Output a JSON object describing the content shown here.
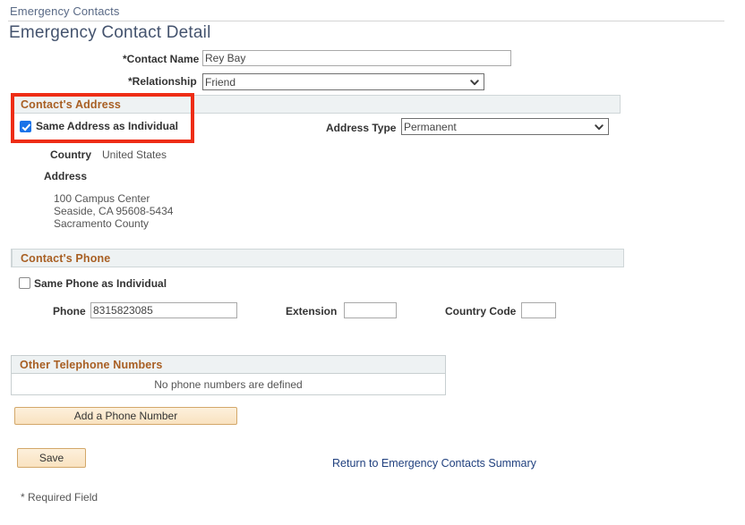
{
  "breadcrumb": {
    "label": "Emergency Contacts"
  },
  "page": {
    "title": "Emergency Contact Detail",
    "required_note": "* Required Field"
  },
  "contact": {
    "name_label": "*Contact Name",
    "name_value": "Rey Bay",
    "relationship_label": "*Relationship",
    "relationship_value": "Friend"
  },
  "address_section": {
    "header": "Contact's Address",
    "same_as_individual_label": "Same Address as Individual",
    "same_as_individual_checked": true,
    "address_type_label": "Address Type",
    "address_type_value": "Permanent",
    "country_label": "Country",
    "country_value": "United States",
    "address_label": "Address",
    "address_lines": [
      "100 Campus Center",
      "Seaside, CA 95608-5434",
      "Sacramento County"
    ]
  },
  "phone_section": {
    "header": "Contact's Phone",
    "same_phone_label": "Same Phone as Individual",
    "same_phone_checked": false,
    "phone_label": "Phone",
    "phone_value": "8315823085",
    "extension_label": "Extension",
    "extension_value": "",
    "country_code_label": "Country Code",
    "country_code_value": ""
  },
  "other_phones": {
    "header": "Other Telephone Numbers",
    "empty_message": "No phone numbers are defined",
    "add_button_label": "Add a Phone Number"
  },
  "actions": {
    "save_label": "Save",
    "return_link_label": "Return to Emergency Contacts Summary"
  },
  "colors": {
    "accent_header": "#a85f23",
    "highlight_box": "#ee2d16",
    "link": "#21417f",
    "title": "#44536e",
    "checkbox_checked": "#1a73e8",
    "button_face": "#f9e2c0"
  }
}
